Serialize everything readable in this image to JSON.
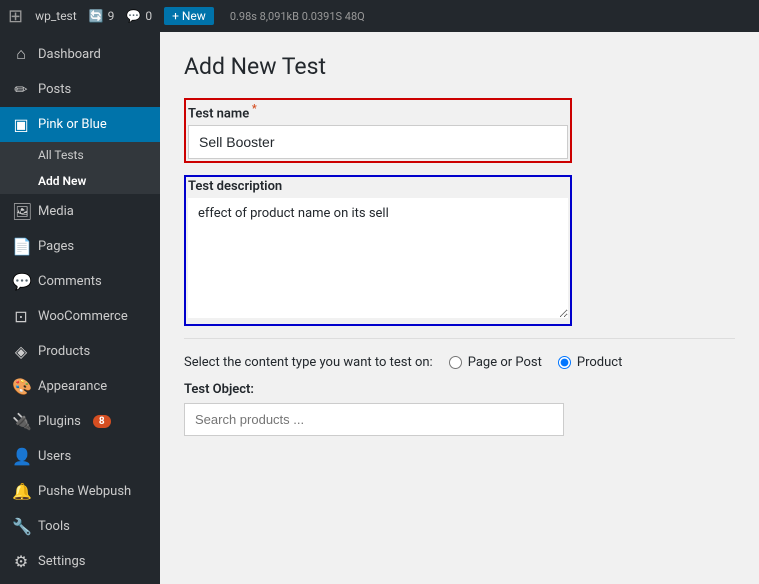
{
  "adminbar": {
    "logo": "⊞",
    "site": "wp_test",
    "updates": "9",
    "comments_icon": "💬",
    "comments_count": "0",
    "new_label": "+ New",
    "metrics": "0.98s  8,091kB  0.0391S  48Q"
  },
  "sidebar": {
    "items": [
      {
        "id": "dashboard",
        "icon": "⌂",
        "label": "Dashboard"
      },
      {
        "id": "posts",
        "icon": "✏",
        "label": "Posts"
      },
      {
        "id": "pink-or-blue",
        "icon": "▣",
        "label": "Pink or Blue",
        "active": true
      },
      {
        "id": "media",
        "icon": "🖼",
        "label": "Media"
      },
      {
        "id": "pages",
        "icon": "📄",
        "label": "Pages"
      },
      {
        "id": "comments",
        "icon": "💬",
        "label": "Comments"
      },
      {
        "id": "woocommerce",
        "icon": "⊡",
        "label": "WooCommerce"
      },
      {
        "id": "products",
        "icon": "◈",
        "label": "Products"
      },
      {
        "id": "appearance",
        "icon": "🎨",
        "label": "Appearance"
      },
      {
        "id": "plugins",
        "icon": "🔌",
        "label": "Plugins",
        "badge": "8"
      },
      {
        "id": "users",
        "icon": "👤",
        "label": "Users"
      },
      {
        "id": "pushe-webpush",
        "icon": "🔔",
        "label": "Pushe Webpush"
      },
      {
        "id": "tools",
        "icon": "🔧",
        "label": "Tools"
      },
      {
        "id": "settings",
        "icon": "⚙",
        "label": "Settings"
      }
    ],
    "submenu": {
      "parent": "pink-or-blue",
      "items": [
        {
          "id": "all-tests",
          "label": "All Tests"
        },
        {
          "id": "add-new",
          "label": "Add New",
          "active": true
        }
      ]
    }
  },
  "main": {
    "page_title": "Add New Test",
    "test_name": {
      "label": "Test name",
      "required": true,
      "value": "Sell Booster",
      "placeholder": ""
    },
    "test_description": {
      "label": "Test description",
      "value": "effect of product name on its sell",
      "placeholder": ""
    },
    "content_type": {
      "label": "Select the content type you want to test on:",
      "options": [
        "Page or Post",
        "Product"
      ],
      "selected": "Product"
    },
    "test_object": {
      "label": "Test Object:",
      "search_placeholder": "Search products ..."
    }
  }
}
